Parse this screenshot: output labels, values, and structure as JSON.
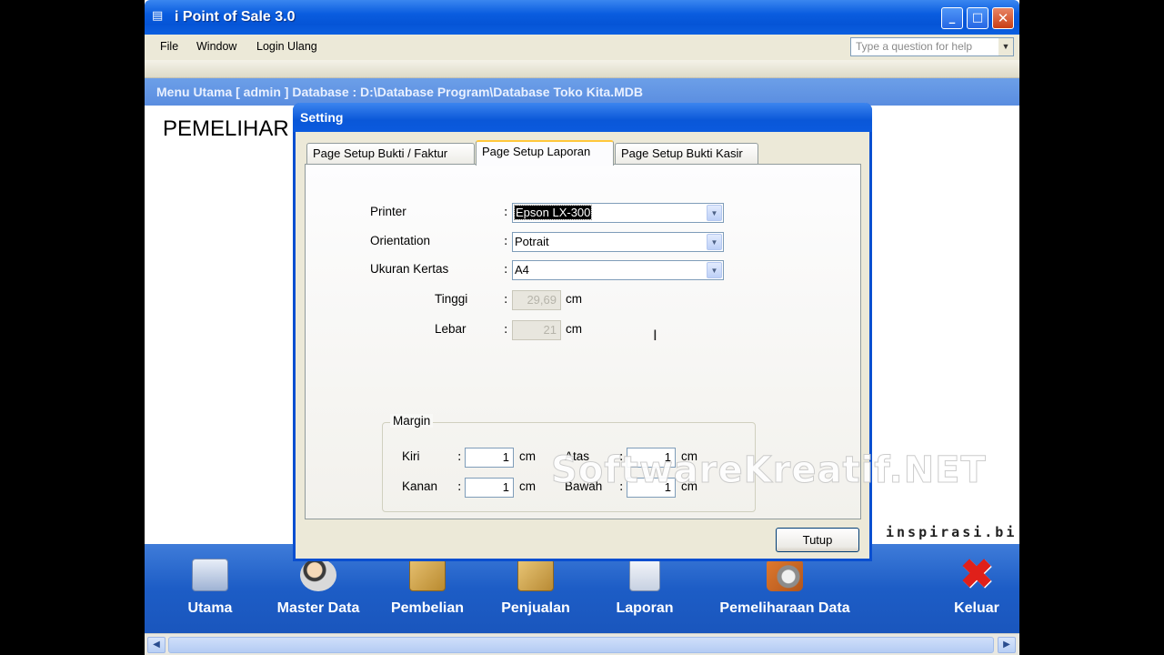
{
  "window": {
    "title": "i Point of Sale 3.0"
  },
  "menu": {
    "file": "File",
    "window": "Window",
    "login": "Login Ulang",
    "help_placeholder": "Type a question for help"
  },
  "infobar": {
    "text": "Menu Utama [ admin ] Database : D:\\Database Program\\Database Toko Kita.MDB"
  },
  "main": {
    "heading": "PEMELIHAR"
  },
  "dialog": {
    "title": "Setting",
    "tabs": [
      "Page Setup Bukti / Faktur",
      "Page Setup Laporan",
      "Page Setup Bukti Kasir"
    ],
    "active_tab": "Page Setup Laporan",
    "printer_label": "Printer",
    "printer_value": "Epson LX-300",
    "orientation_label": "Orientation",
    "orientation_value": "Potrait",
    "paper_label": "Ukuran Kertas",
    "paper_value": "A4",
    "height_label": "Tinggi",
    "height_value": "29,69",
    "width_label": "Lebar",
    "width_value": "21",
    "unit": "cm",
    "colon": ":",
    "margin": {
      "title": "Margin",
      "left_label": "Kiri",
      "left_value": "1",
      "right_label": "Kanan",
      "right_value": "1",
      "top_label": "Atas",
      "top_value": "1",
      "bottom_label": "Bawah",
      "bottom_value": "1"
    },
    "close_button": "Tutup"
  },
  "watermark": "SoftwareKreatif.NET",
  "tagline": "inspirasi.bi",
  "toolbar": {
    "items": [
      {
        "label": "Utama",
        "icon": "building-icon"
      },
      {
        "label": "Master Data",
        "icon": "user-edit-icon"
      },
      {
        "label": "Pembelian",
        "icon": "boxes-icon"
      },
      {
        "label": "Penjualan",
        "icon": "boxes-cart-icon"
      },
      {
        "label": "Laporan",
        "icon": "report-icon"
      },
      {
        "label": "Pemeliharaan Data",
        "icon": "tools-icon"
      },
      {
        "label": "Keluar",
        "icon": "exit-x-icon"
      }
    ]
  },
  "colors": {
    "titlebar": "#0a5ddf",
    "toolbar": "#1d5dc6",
    "dialog_bg": "#ece9d8",
    "exit_red": "#e0201a"
  }
}
